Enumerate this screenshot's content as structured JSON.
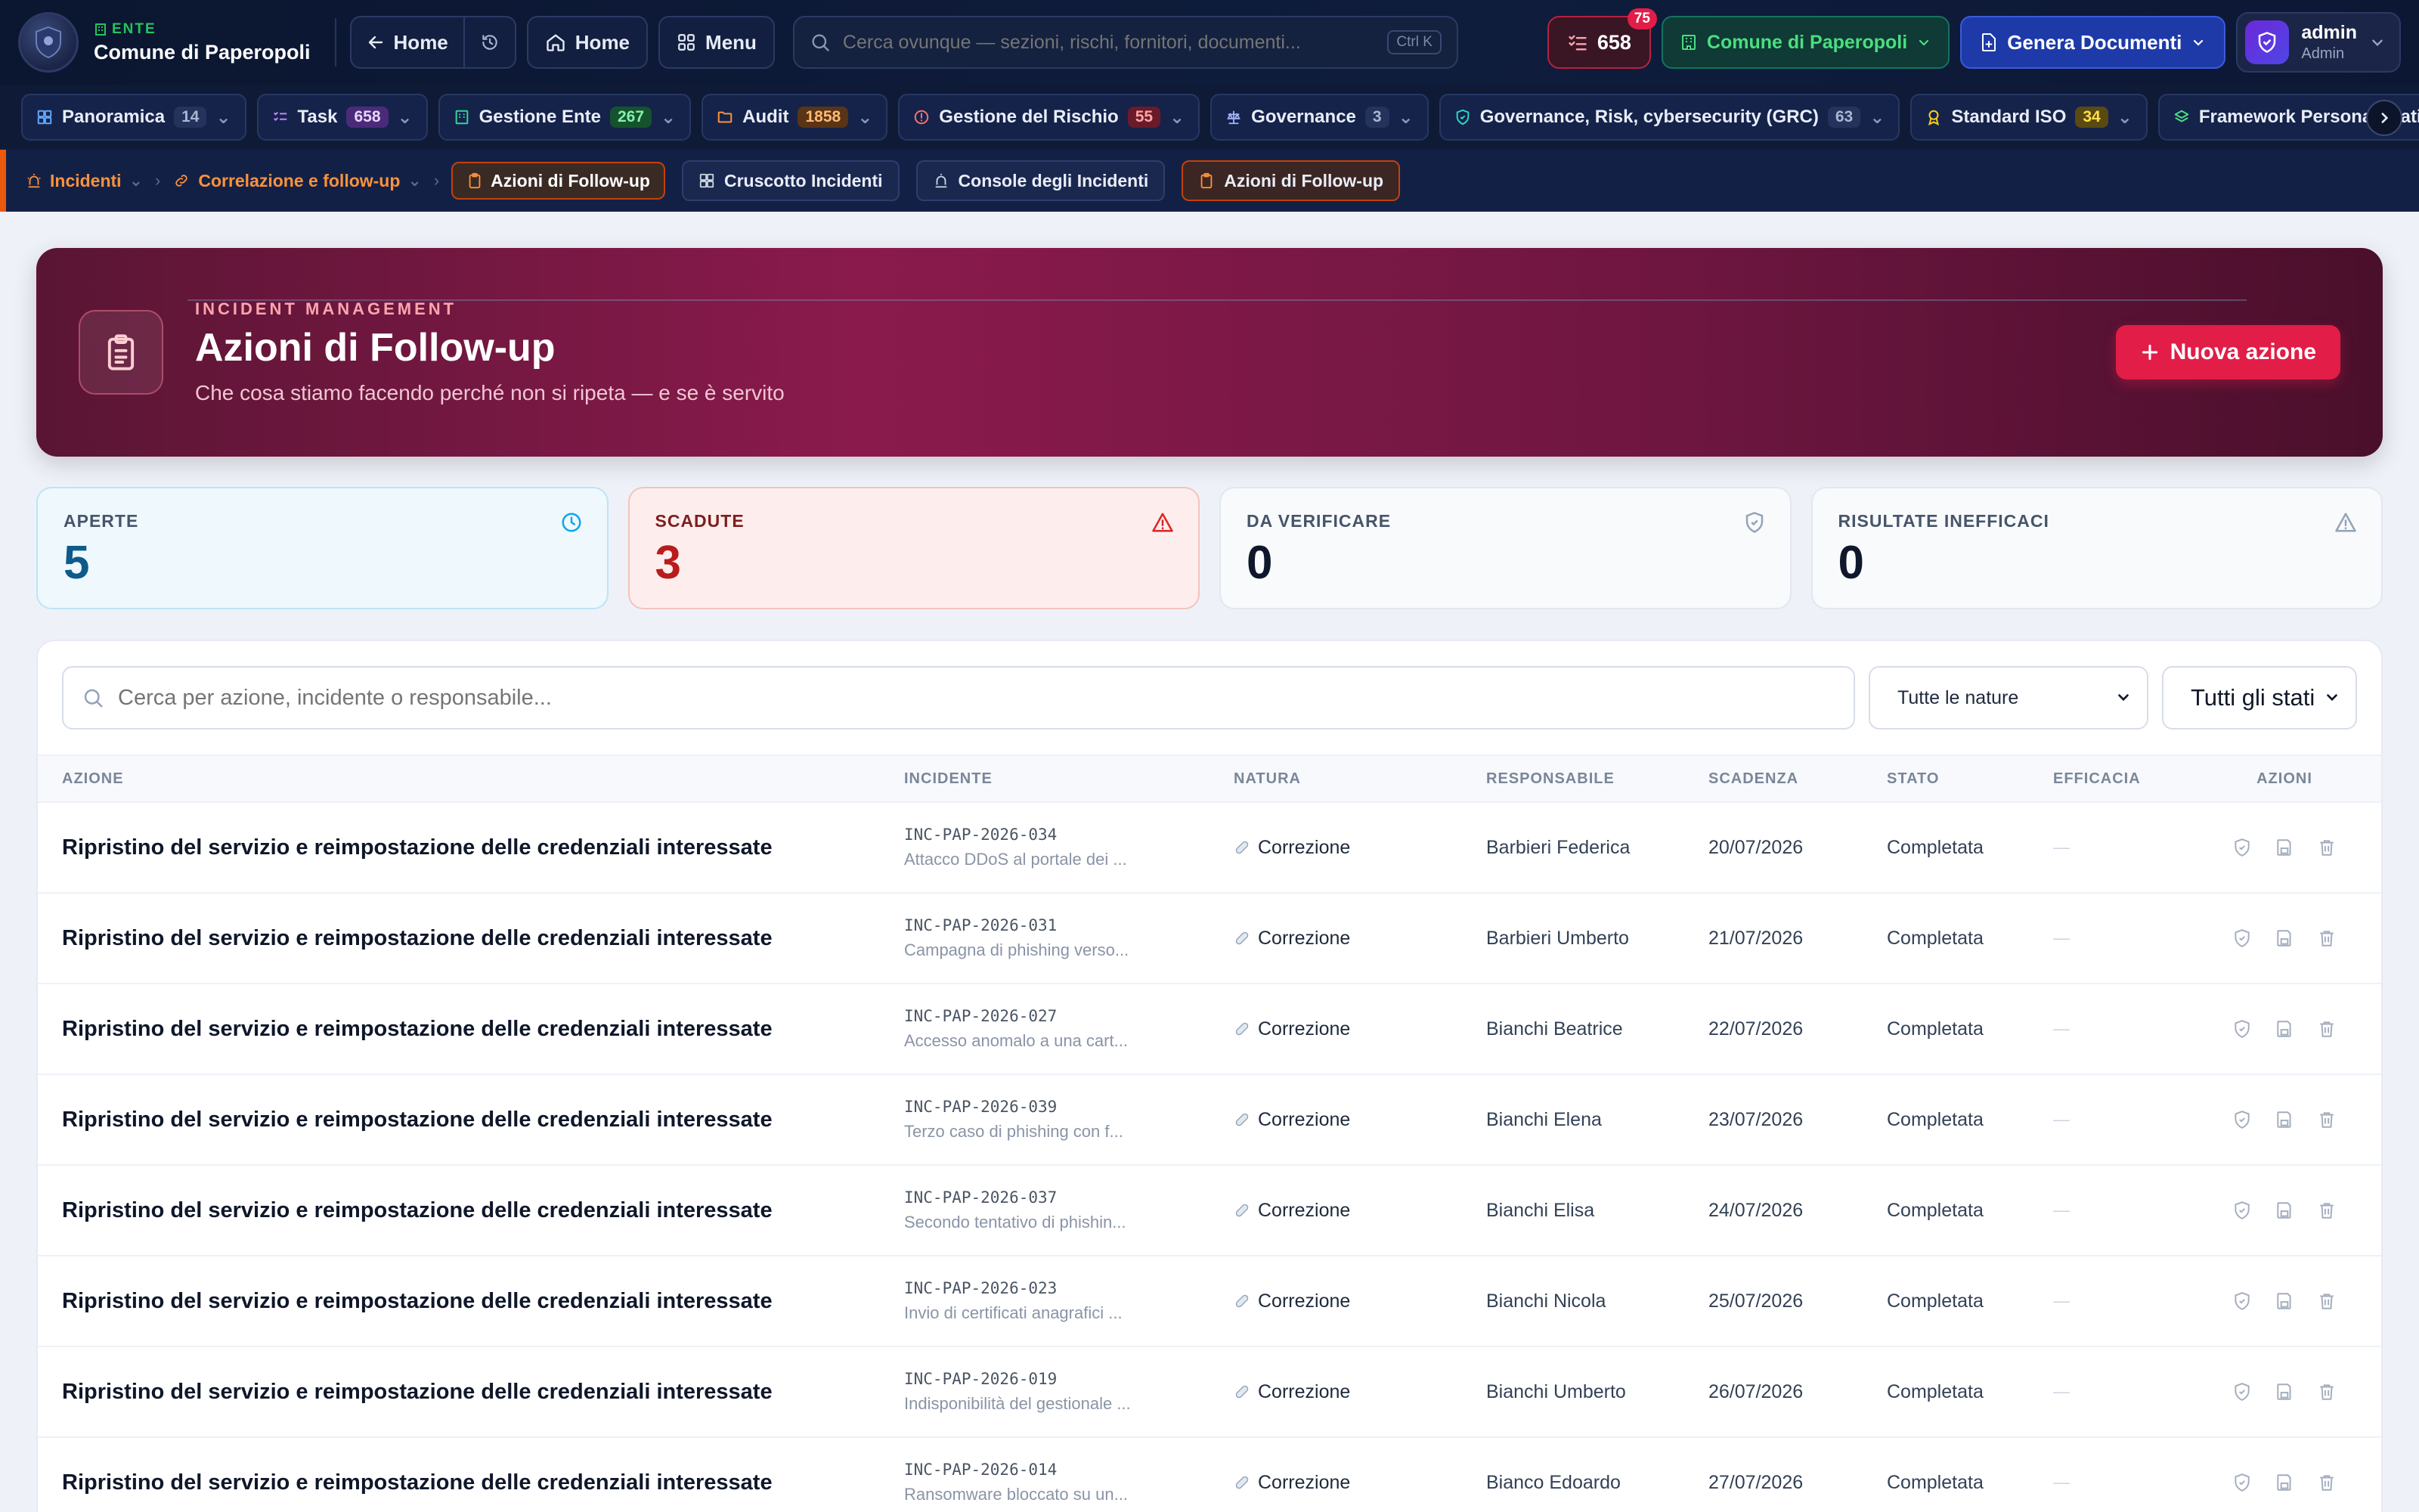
{
  "topbar": {
    "ente_tag": "ENTE",
    "ente_name": "Comune di Paperopoli",
    "back_home_label": "Home",
    "home_label": "Home",
    "menu_label": "Menu",
    "search_placeholder": "Cerca ovunque — sezioni, rischi, fornitori, documenti...",
    "search_shortcut": "Ctrl K",
    "tasks_count": "658",
    "tasks_badge": "75",
    "org_label": "Comune di Paperopoli",
    "generate_label": "Genera Documenti",
    "user_name": "admin",
    "user_role": "Admin"
  },
  "modules": [
    {
      "label": "Panoramica",
      "count": "14"
    },
    {
      "label": "Task",
      "count": "658"
    },
    {
      "label": "Gestione Ente",
      "count": "267"
    },
    {
      "label": "Audit",
      "count": "1858"
    },
    {
      "label": "Gestione del Rischio",
      "count": "55"
    },
    {
      "label": "Governance",
      "count": "3"
    },
    {
      "label": "Governance, Risk, cybersecurity (GRC)",
      "count": "63"
    },
    {
      "label": "Standard ISO",
      "count": "34"
    },
    {
      "label": "Framework Personalizzati",
      "count": ""
    }
  ],
  "breadcrumb": {
    "level1": "Incidenti",
    "level2": "Correlazione e follow-up",
    "current": "Azioni di Follow-up",
    "quick1": "Cruscotto Incidenti",
    "quick2": "Console degli Incidenti",
    "quick3": "Azioni di Follow-up"
  },
  "hero": {
    "kicker": "INCIDENT MANAGEMENT",
    "title": "Azioni di Follow-up",
    "subtitle": "Che cosa stiamo facendo perché non si ripeta — e se è servito",
    "new_button": "Nuova azione"
  },
  "stats": [
    {
      "label": "APERTE",
      "value": "5"
    },
    {
      "label": "SCADUTE",
      "value": "3"
    },
    {
      "label": "DA VERIFICARE",
      "value": "0"
    },
    {
      "label": "RISULTATE INEFFICACI",
      "value": "0"
    }
  ],
  "filters": {
    "search_placeholder": "Cerca per azione, incidente o responsabile...",
    "nature_selected": "Tutte le nature",
    "status_selected": "Tutti gli stati"
  },
  "table": {
    "headers": [
      "AZIONE",
      "INCIDENTE",
      "NATURA",
      "RESPONSABILE",
      "SCADENZA",
      "STATO",
      "EFFICACIA",
      "AZIONI"
    ],
    "rows": [
      {
        "action": "Ripristino del servizio e reimpostazione delle credenziali interessate",
        "inc_code": "INC-PAP-2026-034",
        "inc_title": "Attacco DDoS al portale dei ...",
        "nature": "Correzione",
        "owner": "Barbieri Federica",
        "due": "20/07/2026",
        "status": "Completata",
        "efficacy": "—"
      },
      {
        "action": "Ripristino del servizio e reimpostazione delle credenziali interessate",
        "inc_code": "INC-PAP-2026-031",
        "inc_title": "Campagna di phishing verso...",
        "nature": "Correzione",
        "owner": "Barbieri Umberto",
        "due": "21/07/2026",
        "status": "Completata",
        "efficacy": "—"
      },
      {
        "action": "Ripristino del servizio e reimpostazione delle credenziali interessate",
        "inc_code": "INC-PAP-2026-027",
        "inc_title": "Accesso anomalo a una cart...",
        "nature": "Correzione",
        "owner": "Bianchi Beatrice",
        "due": "22/07/2026",
        "status": "Completata",
        "efficacy": "—"
      },
      {
        "action": "Ripristino del servizio e reimpostazione delle credenziali interessate",
        "inc_code": "INC-PAP-2026-039",
        "inc_title": "Terzo caso di phishing con f...",
        "nature": "Correzione",
        "owner": "Bianchi Elena",
        "due": "23/07/2026",
        "status": "Completata",
        "efficacy": "—"
      },
      {
        "action": "Ripristino del servizio e reimpostazione delle credenziali interessate",
        "inc_code": "INC-PAP-2026-037",
        "inc_title": "Secondo tentativo di phishin...",
        "nature": "Correzione",
        "owner": "Bianchi Elisa",
        "due": "24/07/2026",
        "status": "Completata",
        "efficacy": "—"
      },
      {
        "action": "Ripristino del servizio e reimpostazione delle credenziali interessate",
        "inc_code": "INC-PAP-2026-023",
        "inc_title": "Invio di certificati anagrafici ...",
        "nature": "Correzione",
        "owner": "Bianchi Nicola",
        "due": "25/07/2026",
        "status": "Completata",
        "efficacy": "—"
      },
      {
        "action": "Ripristino del servizio e reimpostazione delle credenziali interessate",
        "inc_code": "INC-PAP-2026-019",
        "inc_title": "Indisponibilità del gestionale ...",
        "nature": "Correzione",
        "owner": "Bianchi Umberto",
        "due": "26/07/2026",
        "status": "Completata",
        "efficacy": "—"
      },
      {
        "action": "Ripristino del servizio e reimpostazione delle credenziali interessate",
        "inc_code": "INC-PAP-2026-014",
        "inc_title": "Ransomware bloccato su un...",
        "nature": "Correzione",
        "owner": "Bianco Edoardo",
        "due": "27/07/2026",
        "status": "Completata",
        "efficacy": "—"
      }
    ]
  },
  "colors": {
    "accent_red": "#e11d48",
    "nav_bg": "#0b1630",
    "breadcrumb_accent": "#ea580c",
    "hero_start": "#5a1534",
    "hero_mid": "#8a1a4c"
  },
  "icons": {
    "tasks": "checklist-icon",
    "generate": "file-plus-icon",
    "user": "shield-icon",
    "row_actions": [
      "verify-shield-icon",
      "save-icon",
      "trash-icon"
    ]
  }
}
